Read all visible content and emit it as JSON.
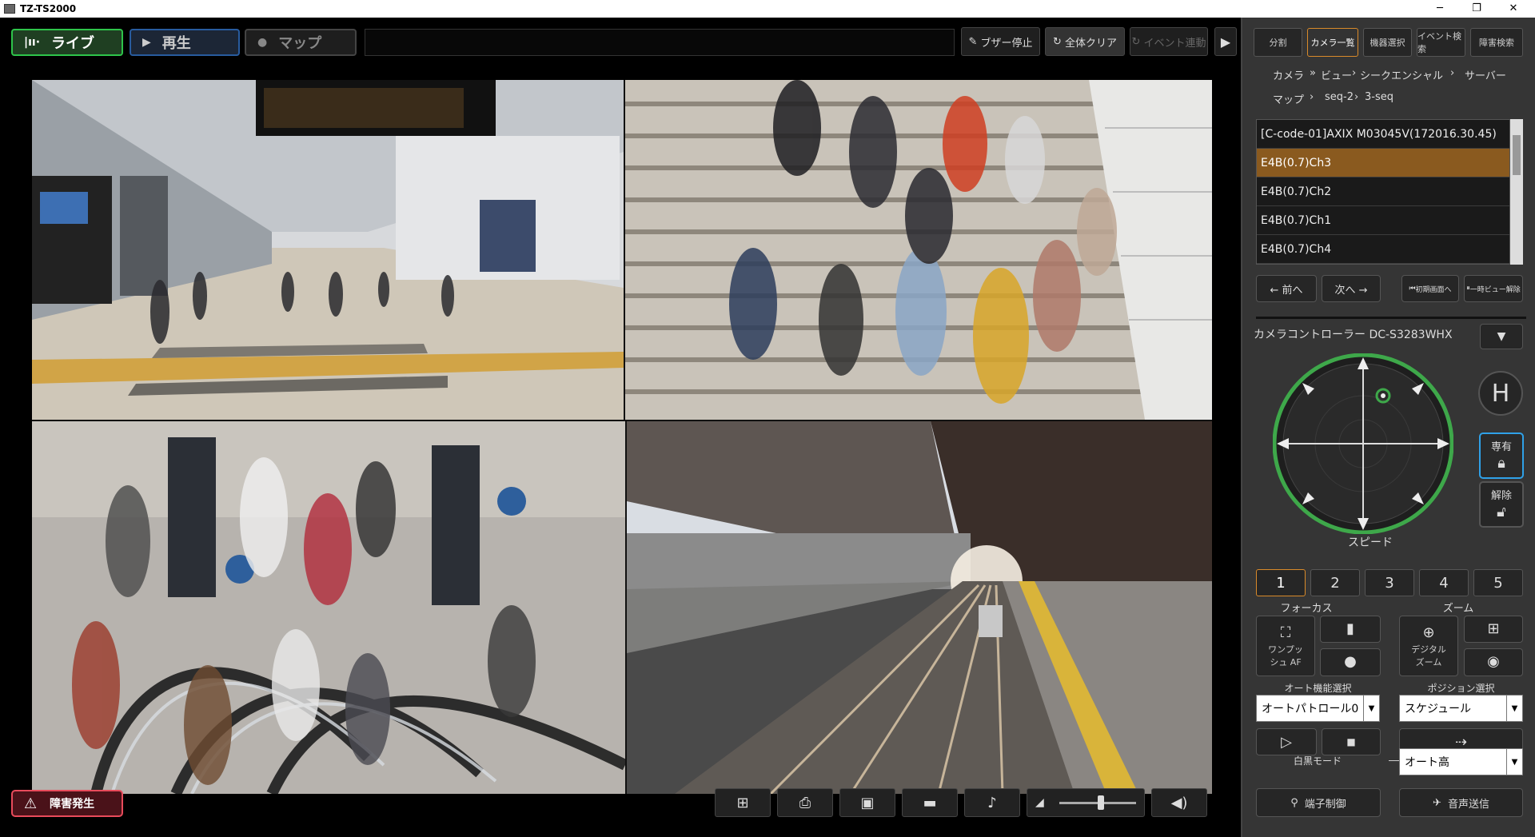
{
  "window": {
    "title": "TZ-TS2000",
    "controls": {
      "minimize": "─",
      "maximize": "❐",
      "close": "✕"
    }
  },
  "nav": {
    "live": {
      "label": "ライブ",
      "icon": "live-icon"
    },
    "playback": {
      "label": "再生",
      "icon": "play-icon"
    },
    "map": {
      "label": "マップ",
      "icon": "map-pin-icon"
    }
  },
  "toolbar": {
    "buzzer_stop": "ブザー停止",
    "clear_all": "全体クリア",
    "event_link": "イベント連動",
    "collapse": "▶"
  },
  "alarm": {
    "label": "障害発生",
    "icon": "warning-icon"
  },
  "bottom_tools": [
    {
      "name": "sequence-icon",
      "glyph": "⊞"
    },
    {
      "name": "print-icon",
      "glyph": "⎙"
    },
    {
      "name": "snapshot-icon",
      "glyph": "▣"
    },
    {
      "name": "display-icon",
      "glyph": "▬"
    },
    {
      "name": "audio-icon",
      "glyph": "♪"
    },
    {
      "name": "volume-level-icon",
      "glyph": "◢"
    },
    {
      "name": "speaker-icon",
      "glyph": "◀)"
    }
  ],
  "volume": {
    "level": 0.55
  },
  "sidebar": {
    "tabs": [
      "分割",
      "カメラ一覧",
      "機器選択",
      "イベント検索",
      "障害検索"
    ],
    "active_tab": 1,
    "breadcrumb_row1": [
      "カメラ",
      "ビュー",
      "シークエンシャル",
      "サーバー"
    ],
    "breadcrumb_row2": [
      "マップ",
      "seq-2",
      "3-seq"
    ],
    "cameras": [
      "[C-code-01]AXIX M03045V(172016.30.45)",
      "E4B(0.7)Ch3",
      "E4B(0.7)Ch2",
      "E4B(0.7)Ch1",
      "E4B(0.7)Ch4"
    ],
    "selected_camera": 1,
    "prev": "← 前へ",
    "next": "次へ →",
    "initial_view": "初期画面へ",
    "pause_view": "一時ビュー解除",
    "controller_title": "カメラコントローラー DC-S3283WHX",
    "home": "H",
    "exclusive": "専有",
    "release": "解除",
    "speed_label": "スピード",
    "speeds": [
      "1",
      "2",
      "3",
      "4",
      "5"
    ],
    "active_speed": 0,
    "focus_label": "フォーカス",
    "zoom_label": "ズーム",
    "one_push_af": "ワンプッシュ AF",
    "digital_zoom": "デジタル ズーム",
    "auto_func_label": "オート機能選択",
    "auto_func_value": "オートパトロール0",
    "position_label": "ポジション選択",
    "position_value": "スケジュール",
    "bw_mode_label": "白黒モード",
    "bw_mode_value": "オート高",
    "terminal_control": "端子制御",
    "audio_send": "音声送信"
  }
}
